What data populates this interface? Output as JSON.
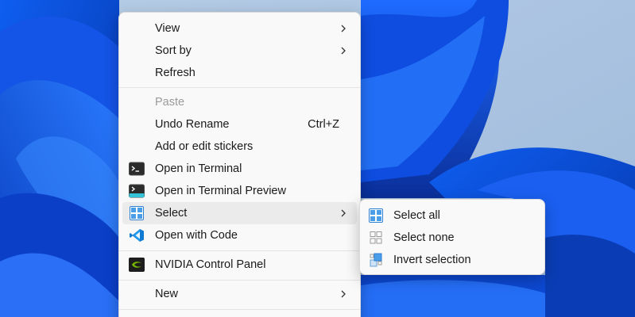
{
  "context_menu": {
    "items": [
      {
        "label": "View",
        "submenu": true
      },
      {
        "label": "Sort by",
        "submenu": true
      },
      {
        "label": "Refresh"
      },
      {
        "label": "Paste",
        "disabled": true
      },
      {
        "label": "Undo Rename",
        "shortcut": "Ctrl+Z"
      },
      {
        "label": "Add or edit stickers"
      },
      {
        "label": "Open in Terminal",
        "icon": "terminal-icon"
      },
      {
        "label": "Open in Terminal Preview",
        "icon": "terminal-preview-icon"
      },
      {
        "label": "Select",
        "icon": "select-grid-icon",
        "submenu": true,
        "highlighted": true
      },
      {
        "label": "Open with Code",
        "icon": "vscode-icon"
      },
      {
        "label": "NVIDIA Control Panel",
        "icon": "nvidia-icon"
      },
      {
        "label": "New",
        "submenu": true
      }
    ]
  },
  "select_submenu": {
    "items": [
      {
        "label": "Select all",
        "icon": "select-all-icon"
      },
      {
        "label": "Select none",
        "icon": "select-none-icon"
      },
      {
        "label": "Invert selection",
        "icon": "invert-selection-icon"
      }
    ]
  },
  "colors": {
    "menu_background": "#f9f9f9",
    "highlight": "#ebebeb",
    "accent": "#0067c0",
    "wallpaper_blue": "#0a4bd6"
  }
}
